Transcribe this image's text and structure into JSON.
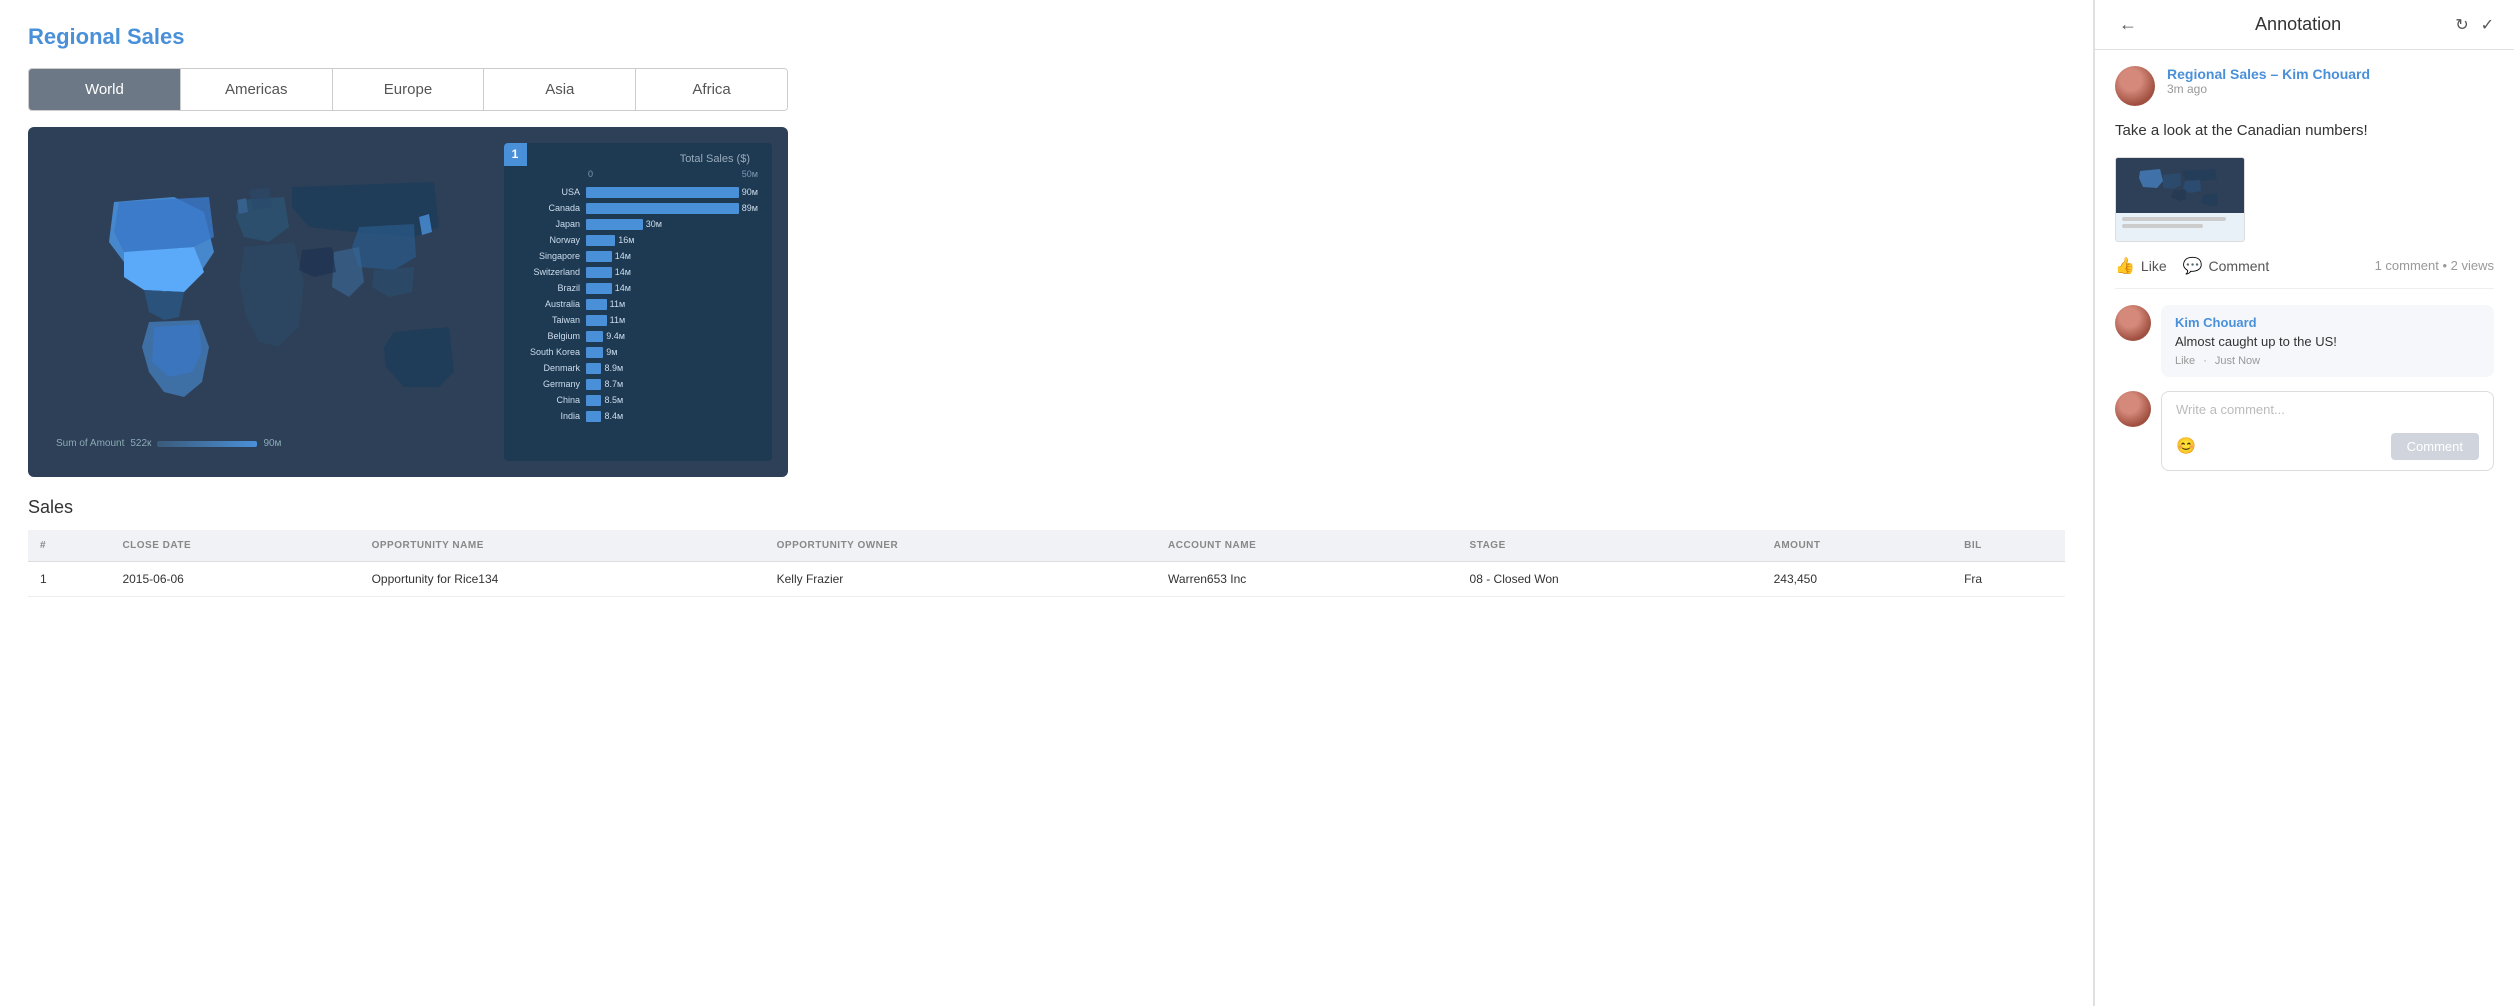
{
  "page": {
    "title": "Regional Sales"
  },
  "tabs": [
    {
      "id": "world",
      "label": "World",
      "active": true
    },
    {
      "id": "americas",
      "label": "Americas",
      "active": false
    },
    {
      "id": "europe",
      "label": "Europe",
      "active": false
    },
    {
      "id": "asia",
      "label": "Asia",
      "active": false
    },
    {
      "id": "africa",
      "label": "Africa",
      "active": false
    }
  ],
  "chart": {
    "badge": "1",
    "title": "Total Sales ($)",
    "scale_start": "0",
    "scale_end": "50м",
    "legend_min": "522к",
    "legend_max": "90м",
    "legend_label": "Sum of Amount",
    "bars": [
      {
        "label": "USA",
        "value": "90м",
        "pct": 100
      },
      {
        "label": "Canada",
        "value": "89м",
        "pct": 98
      },
      {
        "label": "Japan",
        "value": "30м",
        "pct": 33
      },
      {
        "label": "Norway",
        "value": "16м",
        "pct": 17
      },
      {
        "label": "Singapore",
        "value": "14м",
        "pct": 15
      },
      {
        "label": "Switzerland",
        "value": "14м",
        "pct": 15
      },
      {
        "label": "Brazil",
        "value": "14м",
        "pct": 15
      },
      {
        "label": "Australia",
        "value": "11м",
        "pct": 12
      },
      {
        "label": "Taiwan",
        "value": "11м",
        "pct": 12
      },
      {
        "label": "Belgium",
        "value": "9.4м",
        "pct": 10
      },
      {
        "label": "South Korea",
        "value": "9м",
        "pct": 10
      },
      {
        "label": "Denmark",
        "value": "8.9м",
        "pct": 9
      },
      {
        "label": "Germany",
        "value": "8.7м",
        "pct": 9
      },
      {
        "label": "China",
        "value": "8.5м",
        "pct": 9
      },
      {
        "label": "India",
        "value": "8.4м",
        "pct": 9
      }
    ]
  },
  "sales_table": {
    "title": "Sales",
    "columns": [
      "#",
      "CLOSE DATE",
      "OPPORTUNITY NAME",
      "OPPORTUNITY OWNER",
      "ACCOUNT NAME",
      "STAGE",
      "AMOUNT",
      "BIL"
    ],
    "rows": [
      {
        "num": "1",
        "close_date": "2015-06-06",
        "opp_name": "Opportunity for Rice134",
        "opp_owner": "Kelly Frazier",
        "account": "Warren653 Inc",
        "stage": "08 - Closed Won",
        "amount": "243,450",
        "bil": "Fra"
      }
    ]
  },
  "annotation": {
    "header_title": "Annotation",
    "author_name": "Regional Sales – Kim Chouard",
    "author_time": "3m ago",
    "message": "Take a look at the Canadian numbers!",
    "like_label": "Like",
    "comment_label": "Comment",
    "stats": "1 comment • 2 views",
    "comment": {
      "author": "Kim Chouard",
      "text": "Almost caught up to the US!",
      "like": "Like",
      "separator": "·",
      "time": "Just Now"
    },
    "comment_placeholder": "Write a comment...",
    "submit_label": "Comment"
  }
}
